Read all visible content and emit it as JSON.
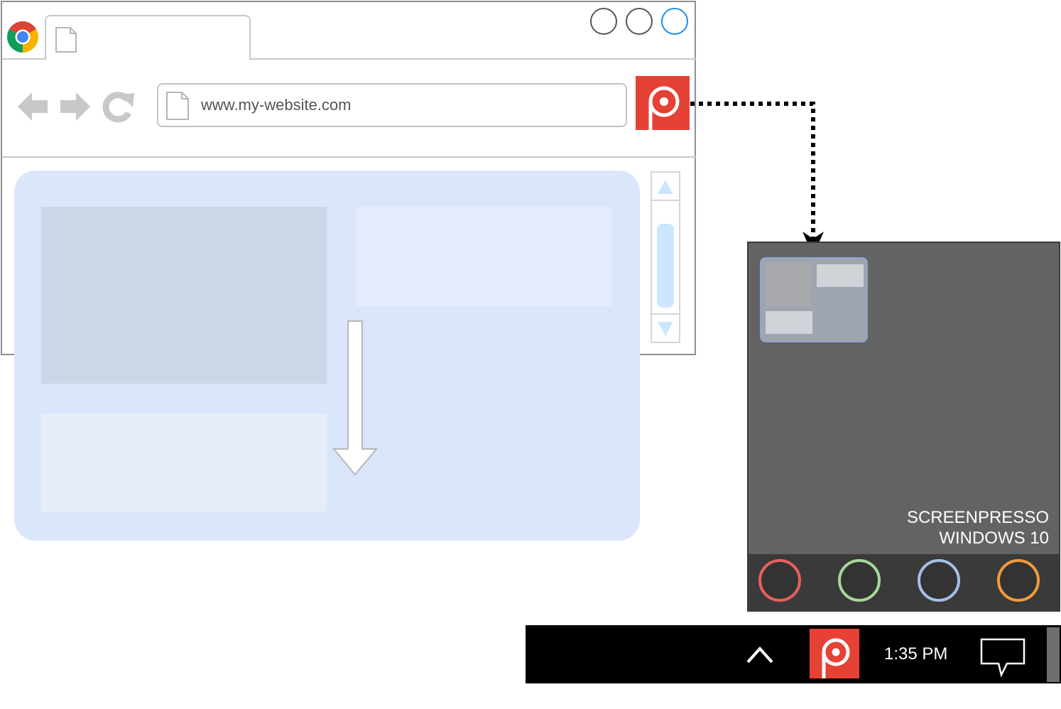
{
  "browser": {
    "address_bar": {
      "url": "www.my-website.com"
    }
  },
  "capture_panel": {
    "title_line1": "SCREENPRESSO",
    "title_line2": "WINDOWS 10",
    "color_buttons": [
      {
        "color": "#e8605d"
      },
      {
        "color": "#a6d79b"
      },
      {
        "color": "#a3bfe8"
      },
      {
        "color": "#f49a3a"
      }
    ]
  },
  "taskbar": {
    "clock": "1:35 PM"
  },
  "colors": {
    "brand_red": "#e64135",
    "content_blue": "#dae6fa",
    "panel_gray": "#636363"
  }
}
